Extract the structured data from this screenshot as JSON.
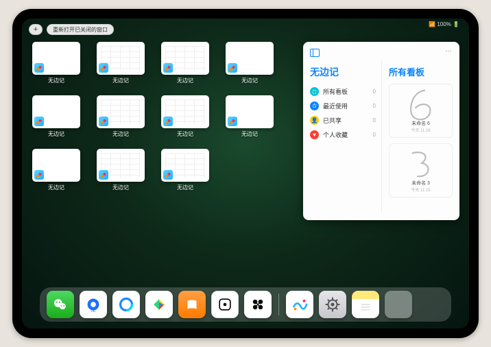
{
  "status": {
    "indicators": "📶 100% 🔋"
  },
  "topbar": {
    "plus": "+",
    "reopen_label": "重新打开已关闭的窗口"
  },
  "app_label": "无边记",
  "thumbs": {
    "count": 11,
    "indices_with_grid": [
      1,
      2,
      5,
      6,
      9,
      10
    ]
  },
  "panel": {
    "left_title": "无边记",
    "right_title": "所有看板",
    "options": "…",
    "items": [
      {
        "icon_color": "#0ac3da",
        "glyph": "◻",
        "label": "所有看板",
        "count": "0"
      },
      {
        "icon_color": "#0a84ff",
        "glyph": "⏱",
        "label": "最近使用",
        "count": "0"
      },
      {
        "icon_color": "#ffcc00",
        "glyph": "👤",
        "label": "已共享",
        "count": "0"
      },
      {
        "icon_color": "#ff3b30",
        "glyph": "♥",
        "label": "个人收藏",
        "count": "0"
      }
    ],
    "boards": [
      {
        "name": "未命名 6",
        "date": "今天 11:29",
        "digit": "6"
      },
      {
        "name": "未命名 3",
        "date": "今天 11:29",
        "digit": "3"
      }
    ]
  },
  "dock": {
    "apps": [
      {
        "name": "wechat-icon"
      },
      {
        "name": "qqhd-icon"
      },
      {
        "name": "qbrowser-icon"
      },
      {
        "name": "play-icon"
      },
      {
        "name": "books-icon"
      },
      {
        "name": "dice-icon"
      },
      {
        "name": "clone-icon"
      }
    ],
    "recent": [
      {
        "name": "freeform-icon"
      },
      {
        "name": "settings-icon"
      },
      {
        "name": "notes-icon"
      },
      {
        "name": "folder-icon"
      }
    ]
  }
}
